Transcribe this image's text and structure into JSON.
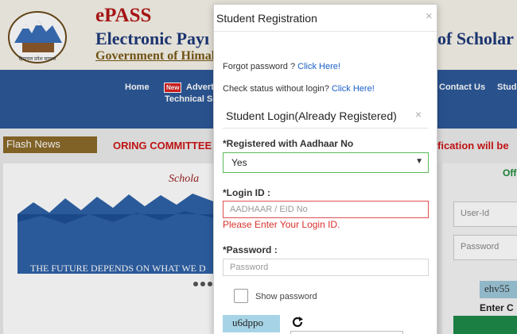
{
  "background": {
    "epass": "ePASS",
    "title_left": "Electronic Payı",
    "title_right": "of Scholar",
    "subtitle": "Government of Himal",
    "logo_caption": "हिमाचल प्रदेश सरकार",
    "nav": {
      "home": "Home",
      "new_badge": "New",
      "advert": "Advert",
      "technical": "Technical Sc",
      "contact": "Contact Us",
      "stude": "Stude"
    },
    "flash_news": "Flash News",
    "marquee_left": "ORING COMMITTEE",
    "marquee_right": "fication will be",
    "banner_text": "THE FUTURE DEPENDS ON WHAT WE D",
    "scholar_logo": "Schola",
    "off_label": "Off",
    "user_id_placeholder": "User-Id",
    "password_placeholder": "Password",
    "captcha_text": "ehv55",
    "enter_c": "Enter C"
  },
  "modal": {
    "title": "Student Registration",
    "close_icon": "×",
    "forgot_text": "Forgot password ? ",
    "forgot_link": "Click Here!",
    "status_text": "Check status without login? ",
    "status_link": "Click Here!",
    "login_title": "Student Login(Already Registered)",
    "login_close": "×",
    "aadhaar_label": "*Registered with Aadhaar No",
    "aadhaar_value": "Yes",
    "login_id_label": "*Login ID :",
    "login_id_placeholder": "AADHAAR / EID No",
    "login_id_error": "Please Enter Your Login ID.",
    "password_label": "*Password :",
    "password_placeholder": "Password",
    "show_password": "Show password",
    "captcha": "u6dppo",
    "refresh_icon": "refresh-icon"
  },
  "colors": {
    "nav": "#2d5a9a",
    "link": "#1a5ec8",
    "error": "#d9312b",
    "valid": "#5cb85c"
  }
}
